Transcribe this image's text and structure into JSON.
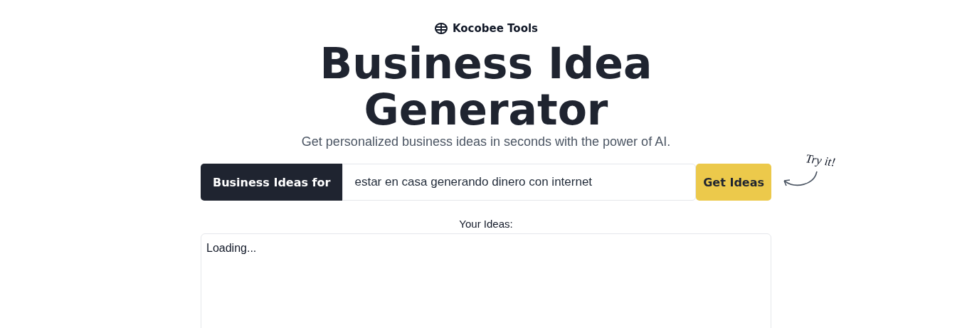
{
  "brand": {
    "name": "Kocobee Tools"
  },
  "title": "Business Idea Generator",
  "subtitle": "Get personalized business ideas in seconds with the power of AI.",
  "form": {
    "prefix": "Business Ideas for",
    "value": "estar en casa generando dinero con internet",
    "button": "Get Ideas",
    "hint": "Try it!"
  },
  "ideas": {
    "label": "Your Ideas:",
    "output": "Loading..."
  }
}
